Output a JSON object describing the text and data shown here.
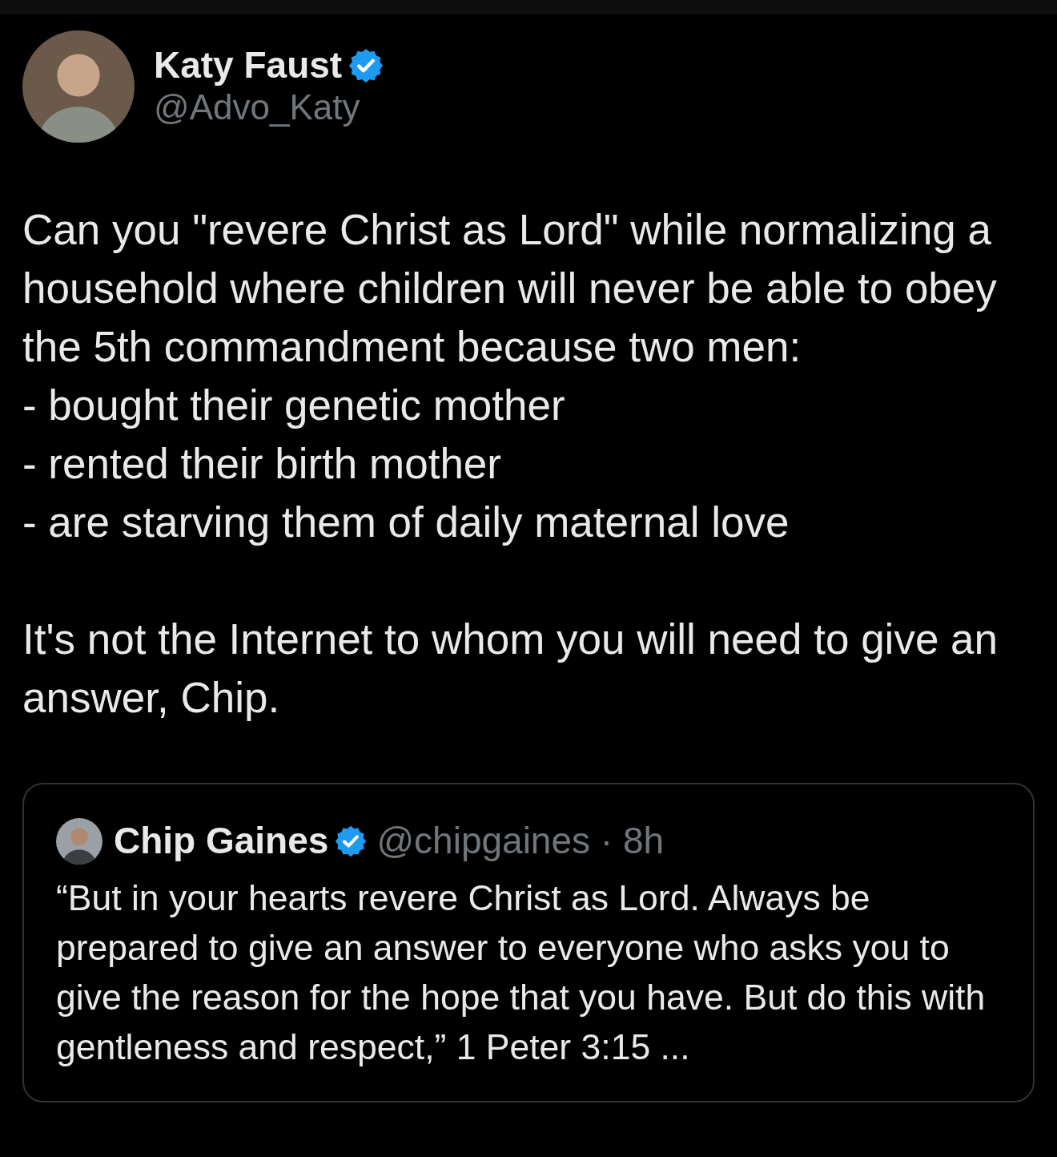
{
  "author": {
    "name": "Katy Faust",
    "verified": true,
    "handle": "@Advo_Katy"
  },
  "text": "Can you \"revere Christ as Lord\" while normalizing a household where children will never be able to obey the 5th commandment because two men:\n- bought their genetic mother\n- rented their birth mother\n- are starving them of daily maternal love\n\nIt's not the Internet to whom you will need to give an answer, Chip.",
  "quote": {
    "author": {
      "name": "Chip Gaines",
      "verified": true,
      "handle": "@chipgaines",
      "separator": "·",
      "time": "8h"
    },
    "text": "“But in your hearts revere Christ as Lord. Always be prepared to give an answer to everyone who asks you to give the reason for the hope that you have. But do this with gentleness and respect,” 1 Peter 3:15 ..."
  }
}
